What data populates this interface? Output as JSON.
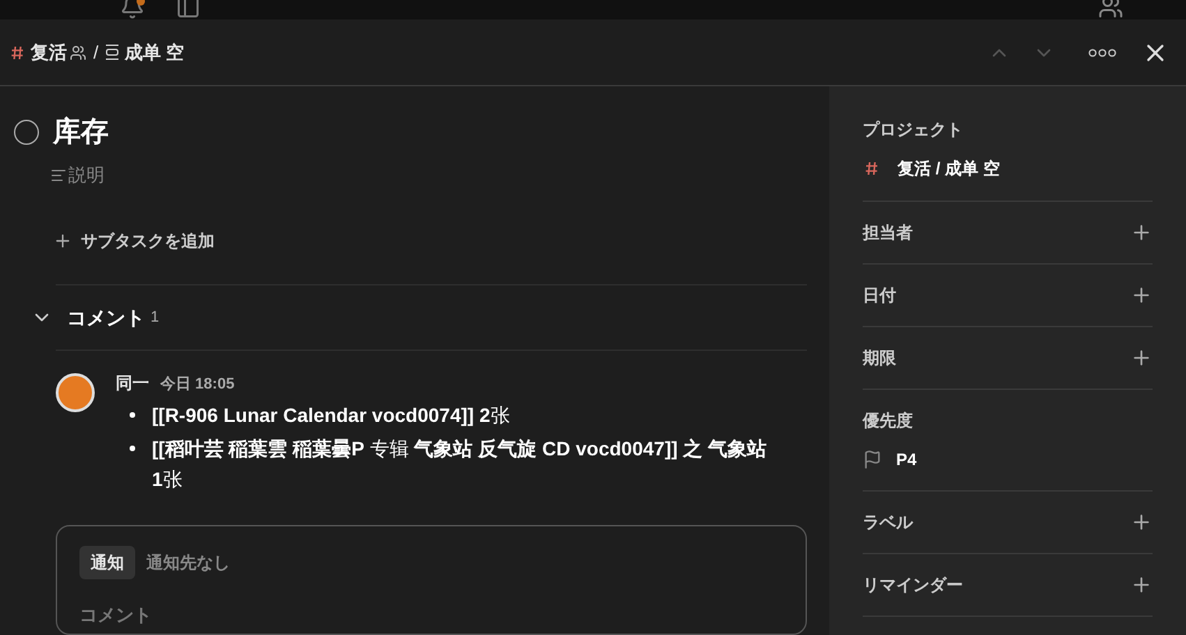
{
  "background": {
    "notification_dot": true
  },
  "header": {
    "project": "复活",
    "separator": "/",
    "section": "成单 空"
  },
  "task": {
    "title": "库存",
    "completed": false,
    "description_placeholder": "説明",
    "add_subtask": "サブタスクを追加"
  },
  "comments": {
    "title": "コメント",
    "count": "1",
    "expanded": true,
    "items": [
      {
        "author": "同一",
        "time": "今日 18:05",
        "bullets": [
          "**[[R-906 Lunar Calendar vocd0074]] 2**张",
          "**[[稻叶芸 稲葉雲 稲葉曇P** 专辑 **气象站 反气旋 CD vocd0047]] 之 气象站 1**张"
        ]
      }
    ],
    "editor": {
      "notify_label": "通知",
      "notify_value": "通知先なし",
      "placeholder": "コメント"
    }
  },
  "sidebar": {
    "project_label": "プロジェクト",
    "project_value": "复活 / 成单 空",
    "rows": [
      {
        "label": "担当者",
        "kind": "add"
      },
      {
        "label": "日付",
        "kind": "add"
      },
      {
        "label": "期限",
        "kind": "add"
      },
      {
        "label": "優先度",
        "kind": "priority",
        "value": "P4"
      },
      {
        "label": "ラベル",
        "kind": "add"
      },
      {
        "label": "リマインダー",
        "kind": "add"
      }
    ]
  }
}
